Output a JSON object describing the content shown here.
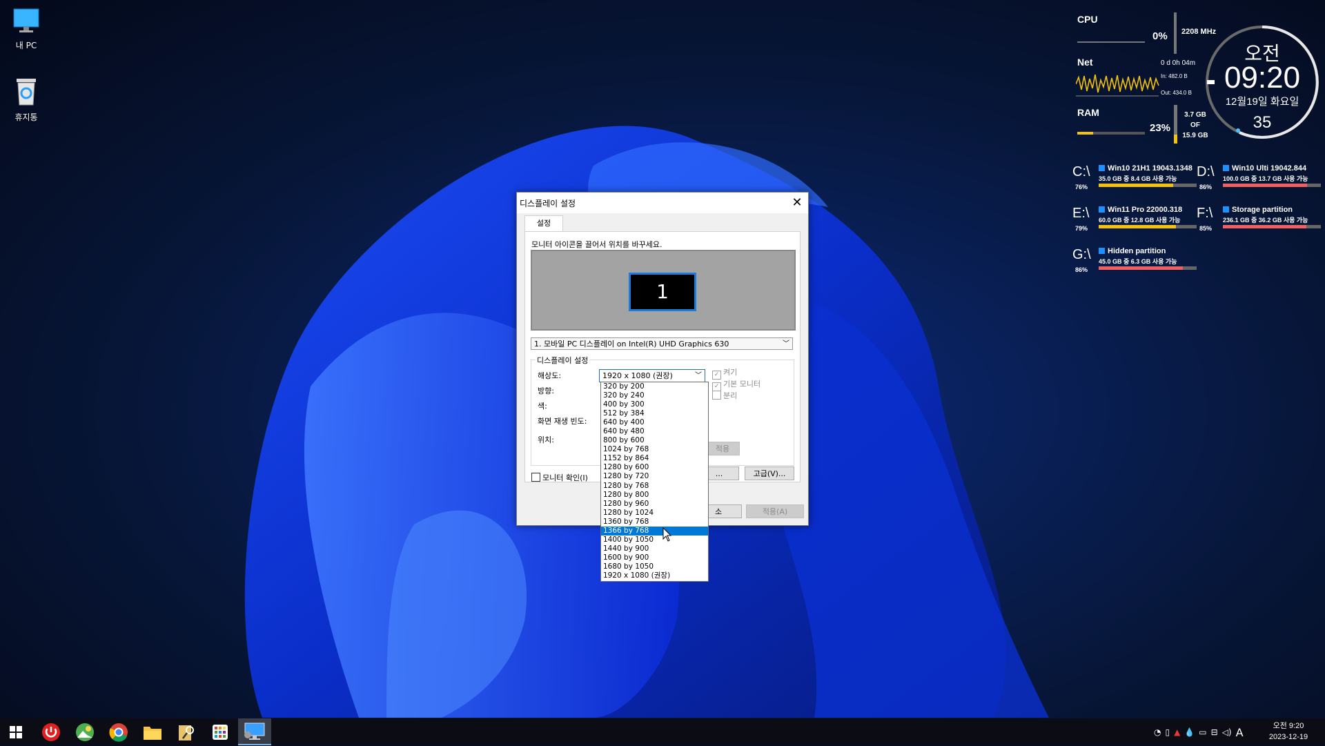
{
  "desktop": {
    "icons": [
      {
        "label": "내 PC",
        "icon": "monitor-icon"
      },
      {
        "label": "휴지통",
        "icon": "recycle-bin-icon"
      }
    ]
  },
  "widgets": {
    "cpu": {
      "label": "CPU",
      "percent": "0%",
      "freq": "2208 MHz",
      "level": 0.0
    },
    "net": {
      "label": "Net",
      "uptime": "0 d 0h 04m",
      "in": "In: 482.0 B",
      "out": "Out: 434.0 B"
    },
    "ram": {
      "label": "RAM",
      "percent": "23%",
      "used": "3.7 GB",
      "of": "OF",
      "total": "15.9 GB",
      "level": 0.23
    },
    "clock": {
      "ampm": "오전",
      "time": "09:20",
      "date": "12월19일 화요일",
      "seconds": "35"
    },
    "drives": [
      {
        "letter": "C:\\",
        "pct": "76%",
        "name": "Win10 21H1 19043.1348",
        "info": "35.0 GB 중   8.4 GB 사용 가능",
        "level": 0.76,
        "color": "#f4c20d"
      },
      {
        "letter": "D:\\",
        "pct": "86%",
        "name": "Win10 Ulti 19042.844",
        "info": "100.0 GB 중  13.7 GB 사용 가능",
        "level": 0.86,
        "color": "#f06060"
      },
      {
        "letter": "E:\\",
        "pct": "79%",
        "name": "Win11 Pro 22000.318",
        "info": "60.0 GB 중   12.8 GB 사용 가능",
        "level": 0.79,
        "color": "#f4c20d"
      },
      {
        "letter": "F:\\",
        "pct": "85%",
        "name": "Storage partition",
        "info": "236.1 GB 중 36.2 GB 사용 가능",
        "level": 0.85,
        "color": "#f06060"
      },
      {
        "letter": "G:\\",
        "pct": "86%",
        "name": "Hidden partition",
        "info": "45.0 GB 중   6.3 GB 사용 가능",
        "level": 0.86,
        "color": "#f06060"
      }
    ]
  },
  "dialog": {
    "title": "디스플레이 설정",
    "tab": "설정",
    "instruction": "모니터 아이콘을 끌어서 위치를 바꾸세요.",
    "monitor_number": "1",
    "monitor_select": "1. 모바일 PC 디스플레이 on Intel(R) UHD Graphics 630",
    "group_title": "디스플레이 설정",
    "labels": {
      "resolution": "해상도:",
      "orientation": "방향:",
      "color": "색:",
      "refresh": "화면 재생 빈도:",
      "position": "위치:"
    },
    "resolution_value": "1920 x 1080 (권장)",
    "checks": {
      "on": "켜기",
      "primary": "기본 모니터",
      "detach": "분리"
    },
    "apply_small": "적용",
    "identify": "모니터 확인(I)",
    "btn_partial": "...",
    "advanced": "고급(V)...",
    "cancel_partial": "소",
    "apply": "적용(A)",
    "close_glyph": "✕"
  },
  "resolution_options": [
    "320 by 200",
    "320 by 240",
    "400 by 300",
    "512 by 384",
    "640 by 400",
    "640 by 480",
    "800 by 600",
    "1024 by 768",
    "1152 by 864",
    "1280 by 600",
    "1280 by 720",
    "1280 by 768",
    "1280 by 800",
    "1280 by 960",
    "1280 by 1024",
    "1360 by 768",
    "1366 by 768",
    "1400 by 1050",
    "1440 by 900",
    "1600 by 900",
    "1680 by 1050",
    "1920 x 1080 (권장)"
  ],
  "selected_resolution": "1366 by 768",
  "taskbar": {
    "apps": [
      "start-icon",
      "power-icon",
      "photos-icon",
      "chrome-icon",
      "file-explorer-icon",
      "search-tool-icon",
      "app-grid-icon",
      "display-settings-icon"
    ],
    "tray_ime": "A",
    "time": "오전 9:20",
    "date": "2023-12-19"
  }
}
